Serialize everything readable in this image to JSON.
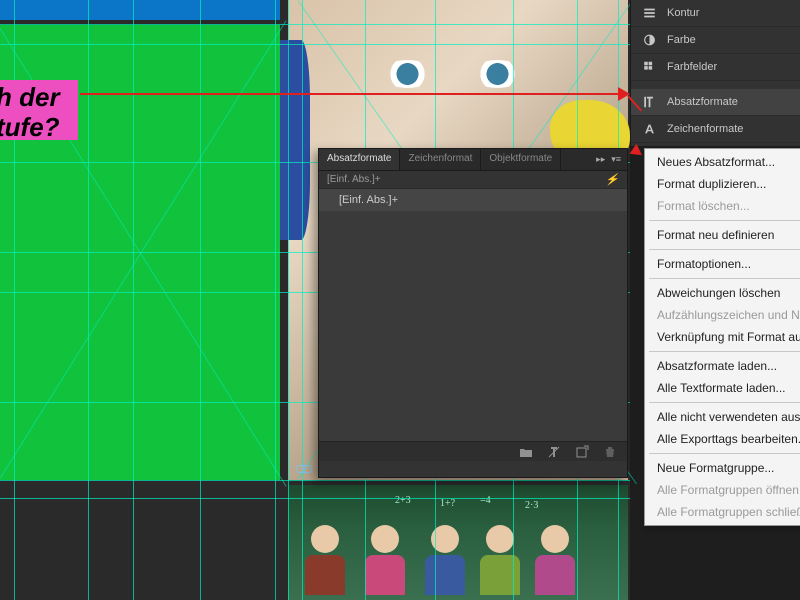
{
  "text_fragments": {
    "line1": "h der",
    "line2": "tufe?"
  },
  "side_panels": {
    "items": [
      {
        "label": "Kontur",
        "icon": "stroke"
      },
      {
        "label": "Farbe",
        "icon": "color"
      },
      {
        "label": "Farbfelder",
        "icon": "swatches"
      },
      {
        "label": "Absatzformate",
        "icon": "paragraph-styles"
      },
      {
        "label": "Zeichenformate",
        "icon": "char-styles"
      }
    ],
    "active_index": 3
  },
  "formats_panel": {
    "tabs": [
      {
        "label": "Absatzformate",
        "active": true
      },
      {
        "label": "Zeichenformat",
        "active": false
      },
      {
        "label": "Objektformate",
        "active": false
      }
    ],
    "current_style": "[Einf. Abs.]+",
    "items": [
      "[Einf. Abs.]+"
    ],
    "footer_icons": [
      "folder",
      "clear-override",
      "new",
      "trash"
    ]
  },
  "context_menu": {
    "groups": [
      [
        {
          "label": "Neues Absatzformat...",
          "enabled": true
        },
        {
          "label": "Format duplizieren...",
          "enabled": true
        },
        {
          "label": "Format löschen...",
          "enabled": false
        }
      ],
      [
        {
          "label": "Format neu definieren",
          "enabled": true
        }
      ],
      [
        {
          "label": "Formatoptionen...",
          "enabled": true
        }
      ],
      [
        {
          "label": "Abweichungen löschen",
          "enabled": true
        },
        {
          "label": "Aufzählungszeichen und Nummerierung in Text konvertieren",
          "enabled": false
        },
        {
          "label": "Verknüpfung mit Format aufheben",
          "enabled": true
        }
      ],
      [
        {
          "label": "Absatzformate laden...",
          "enabled": true
        },
        {
          "label": "Alle Textformate laden...",
          "enabled": true
        }
      ],
      [
        {
          "label": "Alle nicht verwendeten auswählen",
          "enabled": true
        },
        {
          "label": "Alle Exporttags bearbeiten...",
          "enabled": true
        }
      ],
      [
        {
          "label": "Neue Formatgruppe...",
          "enabled": true
        },
        {
          "label": "Alle Formatgruppen öffnen",
          "enabled": false
        },
        {
          "label": "Alle Formatgruppen schließen",
          "enabled": false
        }
      ]
    ]
  },
  "chalk": {
    "a": "2+3",
    "b": "1+?",
    "c": "=4",
    "d": "2·3"
  }
}
